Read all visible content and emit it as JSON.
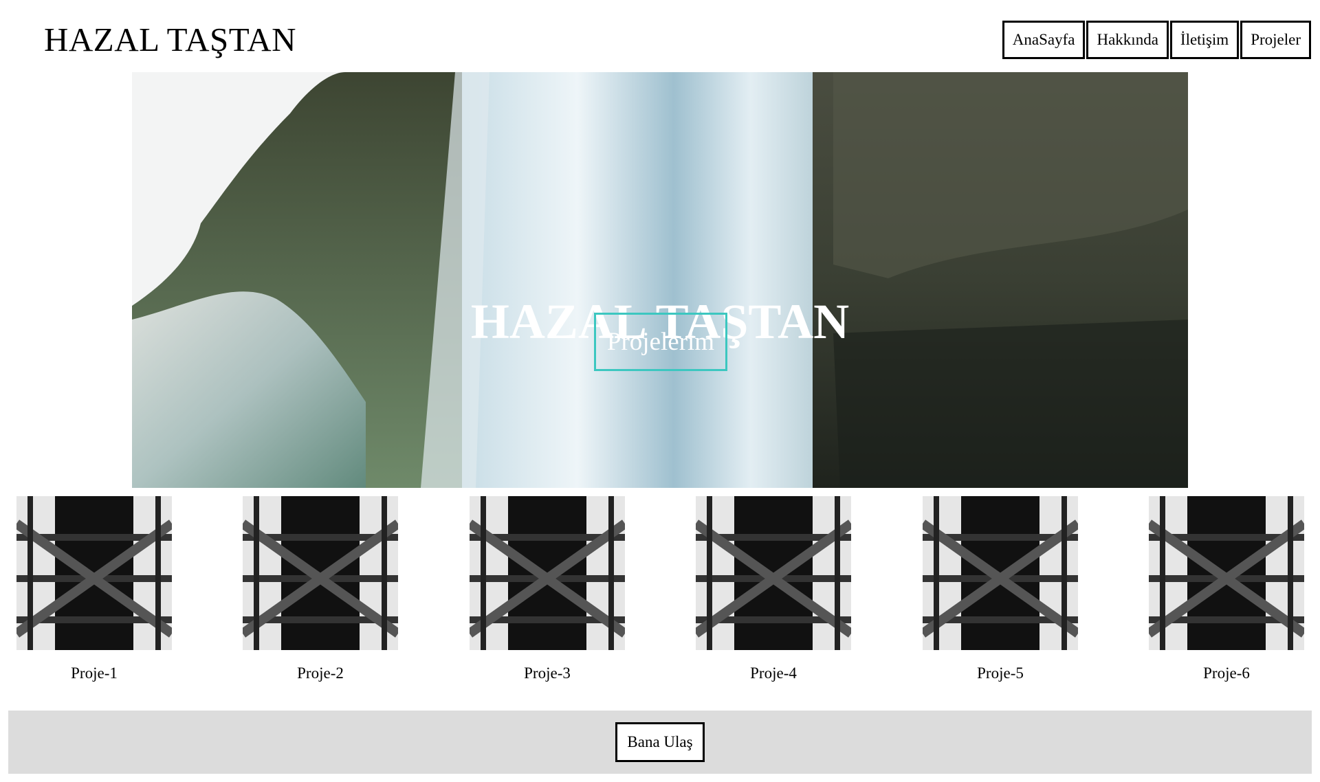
{
  "header": {
    "brand": "HAZAL TAŞTAN",
    "nav": [
      "AnaSayfa",
      "Hakkında",
      "İletişim",
      "Projeler"
    ]
  },
  "hero": {
    "title": "HAZAL TAŞTAN",
    "button_label": "Projelerim",
    "button_border_color": "#3cc7c0",
    "image": "waterfall-photo"
  },
  "projects": [
    {
      "label": "Proje-1",
      "image": "steel-tower-photo"
    },
    {
      "label": "Proje-2",
      "image": "steel-tower-photo"
    },
    {
      "label": "Proje-3",
      "image": "steel-tower-photo"
    },
    {
      "label": "Proje-4",
      "image": "steel-tower-photo"
    },
    {
      "label": "Proje-5",
      "image": "steel-tower-photo"
    },
    {
      "label": "Proje-6",
      "image": "steel-tower-photo"
    }
  ],
  "footer": {
    "contact_label": "Bana Ulaş",
    "background_color": "#dcdcdc"
  }
}
